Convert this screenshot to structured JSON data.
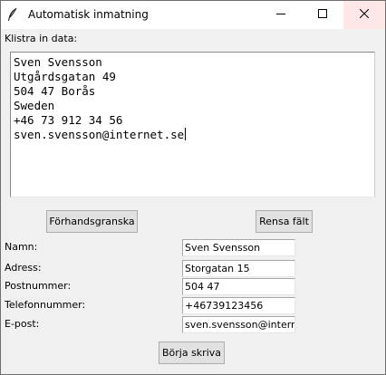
{
  "window": {
    "title": "Automatisk inmatning",
    "title_icon": "feather-icon",
    "controls": [
      "minimize-icon",
      "maximize-icon",
      "close-icon"
    ]
  },
  "paste": {
    "label": "Klistra in data:",
    "lines": [
      "Sven Svensson",
      "Utgårdsgatan 49",
      "504 47 Borås",
      "Sweden",
      "+46 73 912 34 56",
      "sven.svensson@internet.se"
    ]
  },
  "buttons": {
    "preview": "Förhandsgranska",
    "clear": "Rensa fält",
    "start": "Börja skriva"
  },
  "form": {
    "name_label": "Namn:",
    "name_value": "Sven Svensson",
    "address_label": "Adress:",
    "address_value": "Storgatan 15",
    "postal_label": "Postnummer:",
    "postal_value": "504 47",
    "phone_label": "Telefonnummer:",
    "phone_value": "+46739123456",
    "email_label": "E-post:",
    "email_value": "sven.svensson@internet.se"
  },
  "colors": {
    "close_hover_bg": "#ffe7e7",
    "button_bg": "#e1e1e1",
    "window_bg": "#f0f0f0"
  }
}
